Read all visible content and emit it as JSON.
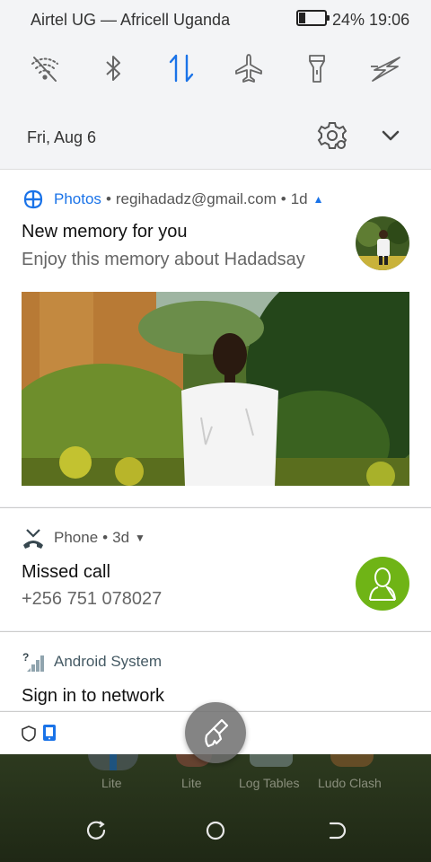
{
  "status_bar": {
    "carrier": "Airtel UG — Africell Uganda",
    "battery_percent": "24%",
    "battery_level": 0.24,
    "time": "19:06"
  },
  "quick_settings": [
    {
      "icon": "wifi-off-icon",
      "active": false
    },
    {
      "icon": "bluetooth-icon",
      "active": false
    },
    {
      "icon": "mobile-data-icon",
      "active": true
    },
    {
      "icon": "airplane-icon",
      "active": false
    },
    {
      "icon": "flashlight-icon",
      "active": false
    },
    {
      "icon": "power-saver-icon",
      "active": false
    }
  ],
  "date": "Fri, Aug 6",
  "notifications": {
    "photos": {
      "app": "Photos",
      "account": "regihadadz@gmail.com",
      "age": "1d",
      "title": "New memory for you",
      "text": "Enjoy this memory about Hadadsay"
    },
    "phone": {
      "app": "Phone",
      "age": "3d",
      "title": "Missed call",
      "text": "+256 751 078027"
    },
    "android": {
      "app": "Android System",
      "title": "Sign in to network"
    }
  },
  "home_apps": [
    "Lite",
    "Lite",
    "Log Tables",
    "Ludo Clash"
  ],
  "colors": {
    "accent_blue": "#1a73e8",
    "contact_green": "#6fb416",
    "panel_bg": "#f3f4f6"
  }
}
